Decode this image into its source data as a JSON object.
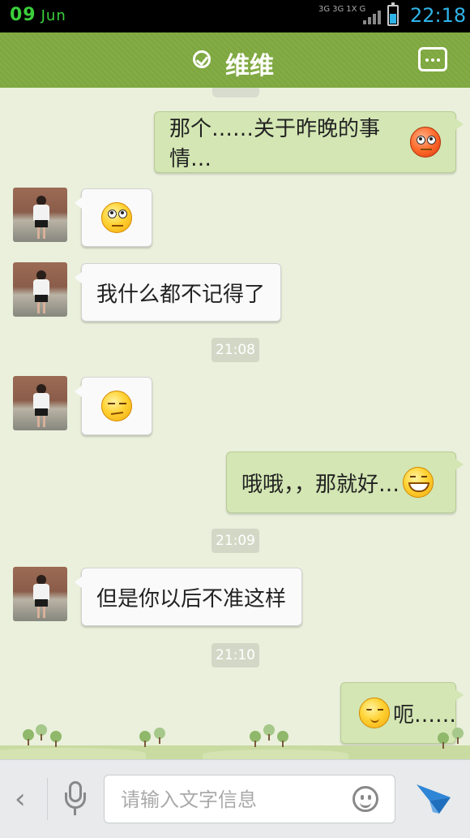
{
  "status_bar": {
    "date_day": "09",
    "date_month": "Jun",
    "network_labels": [
      "3G",
      "3G",
      "1X",
      "G"
    ],
    "battery_level": 0.55,
    "time": "22:18",
    "accent_color": "#2fb4e8"
  },
  "header": {
    "status_icon": "check-circle-icon",
    "title": "维维",
    "menu_icon": "more-dots-icon",
    "color": "#7ea83f"
  },
  "messages": [
    {
      "side": "right",
      "text": "那个……关于昨晚的事情…",
      "emoji": "embarrassed-face-icon"
    },
    {
      "side": "left",
      "text": "",
      "emoji": "eye-roll-face-icon"
    },
    {
      "side": "left",
      "text": "我什么都不记得了"
    },
    {
      "type": "time",
      "text": "21:08"
    },
    {
      "side": "left",
      "text": "",
      "emoji": "sulky-face-icon"
    },
    {
      "side": "right",
      "text": "哦哦，，那就好…",
      "emoji": "grin-face-icon"
    },
    {
      "type": "time",
      "text": "21:09"
    },
    {
      "side": "left",
      "text": "但是你以后不准这样"
    },
    {
      "type": "time",
      "text": "21:10"
    },
    {
      "side": "right",
      "text": "呃……",
      "emoji": "shy-smile-face-icon"
    }
  ],
  "input_bar": {
    "back_icon": "chevron-left-icon",
    "voice_icon": "microphone-icon",
    "placeholder": "请输入文字信息",
    "emoji_icon": "smiley-icon",
    "send_icon": "send-plane-icon",
    "send_color": "#2f86d6"
  }
}
